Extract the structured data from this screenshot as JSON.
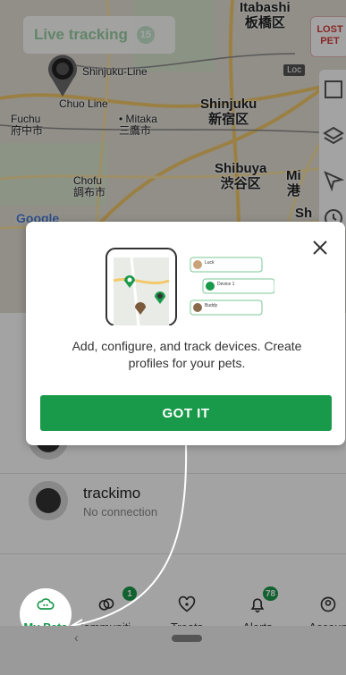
{
  "map": {
    "live_tracking_label": "Live tracking",
    "live_tracking_count": "15",
    "lost_pet_label_1": "LOST",
    "lost_pet_label_2": "PET",
    "location_tag": "Loc",
    "labels": {
      "itabashi_en": "Itabashi",
      "itabashi_jp": "板橋区",
      "shinjuku_line": "Shinjuku-Line",
      "chuo_line": "Chuo Line",
      "fuchu_en": "Fuchu",
      "fuchu_jp": "府中市",
      "mitaka_en": "Mitaka",
      "mitaka_jp": "三鷹市",
      "shinjuku_en": "Shinjuku",
      "shinjuku_jp": "新宿区",
      "chofu_en": "Chofu",
      "chofu_jp": "調布市",
      "shibuya_en": "Shibuya",
      "shibuya_jp": "渋谷区",
      "minato_en": "Mi",
      "minato_jp": "港",
      "sh_partial": "Sh",
      "google": "Google"
    }
  },
  "pets": [
    {
      "name": "",
      "status": ""
    },
    {
      "name": "trackimo",
      "status": "No connection"
    }
  ],
  "modal": {
    "message": "Add, configure, and track devices. Create profiles for your pets.",
    "button_label": "GOT IT",
    "illustration_cards": [
      "Luck",
      "Device 1",
      "Buddy"
    ]
  },
  "bottom_nav": {
    "items": [
      {
        "label": "My Pets",
        "icon": "cloud-paw-icon",
        "badge": ""
      },
      {
        "label": "Communiti...",
        "icon": "community-icon",
        "badge": "1"
      },
      {
        "label": "Treats",
        "icon": "heart-paw-icon",
        "badge": ""
      },
      {
        "label": "Alerts",
        "icon": "bell-icon",
        "badge": "78"
      },
      {
        "label": "Accoun",
        "icon": "account-icon",
        "badge": ""
      }
    ]
  },
  "colors": {
    "accent": "#199a4a",
    "lost": "#d83a3a",
    "map_bg": "#e4e0d6"
  }
}
